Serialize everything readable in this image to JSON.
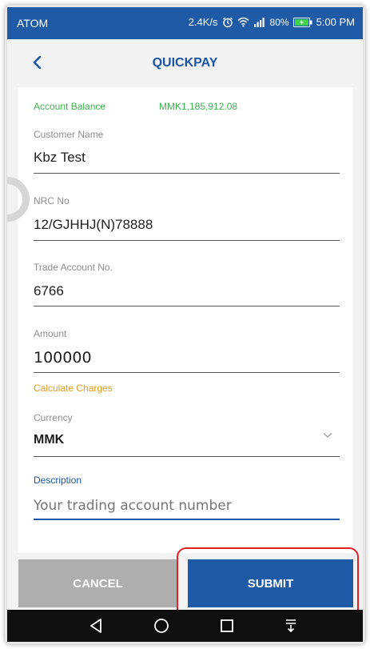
{
  "status_bar": {
    "carrier": "ATOM",
    "speed": "2.4K/s",
    "battery": "80%",
    "time": "5:00 PM"
  },
  "header": {
    "title": "QUICKPAY"
  },
  "form": {
    "balance_label": "Account Balance",
    "balance_value": "MMK1,185,912.08",
    "customer_name_label": "Customer Name",
    "customer_name_value": "Kbz Test",
    "nrc_label": "NRC No",
    "nrc_value": "12/GJHHJ(N)78888",
    "trade_account_label": "Trade Account No.",
    "trade_account_value": "6766",
    "amount_label": "Amount",
    "amount_value": "100000",
    "calculate_charges_label": "Calculate Charges",
    "currency_label": "Currency",
    "currency_value": "MMK",
    "description_label": "Description",
    "description_placeholder": "Your trading account number"
  },
  "actions": {
    "cancel_label": "CANCEL",
    "submit_label": "SUBMIT"
  },
  "icons": {
    "back": "chevron-left-icon",
    "currency_dropdown": "chevron-down-icon",
    "nav": [
      "back-triangle-icon",
      "home-circle-icon",
      "recents-square-icon",
      "notification-pulldown-icon"
    ]
  },
  "colors": {
    "brand_blue": "#1f5aa6",
    "balance_green": "#3bb34a",
    "charges_orange": "#e59a1b",
    "highlight_red": "#e02424"
  }
}
